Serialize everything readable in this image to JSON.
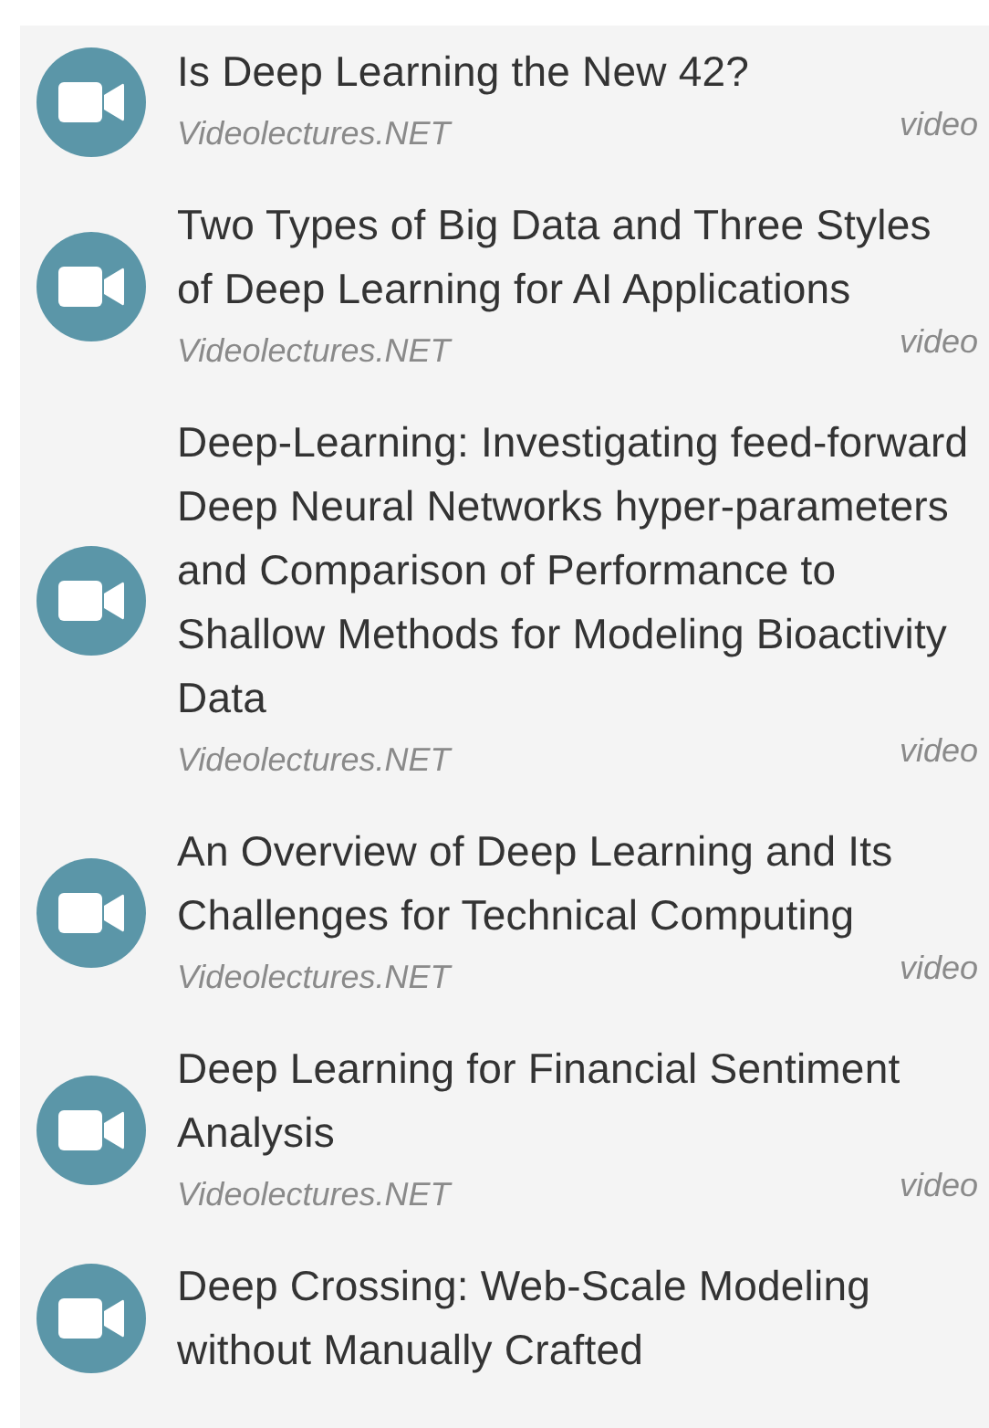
{
  "results": [
    {
      "title": "Is Deep Learning the New 42?",
      "source": "Videolectures.NET",
      "type": "video"
    },
    {
      "title": "Two Types of Big Data and Three Styles of Deep Learning for AI Applications",
      "source": "Videolectures.NET",
      "type": "video"
    },
    {
      "title": "Deep-Learning: Investigating feed-forward Deep Neural Networks hyper-parameters and Comparison of Performance to Shallow Methods for Modeling Bioactivity Data",
      "source": "Videolectures.NET",
      "type": "video"
    },
    {
      "title": "An Overview of Deep Learning and Its Challenges for Technical Computing",
      "source": "Videolectures.NET",
      "type": "video"
    },
    {
      "title": "Deep Learning for Financial Sentiment Analysis",
      "source": "Videolectures.NET",
      "type": "video"
    },
    {
      "title": "Deep Crossing: Web-Scale Modeling without Manually Crafted"
    }
  ]
}
